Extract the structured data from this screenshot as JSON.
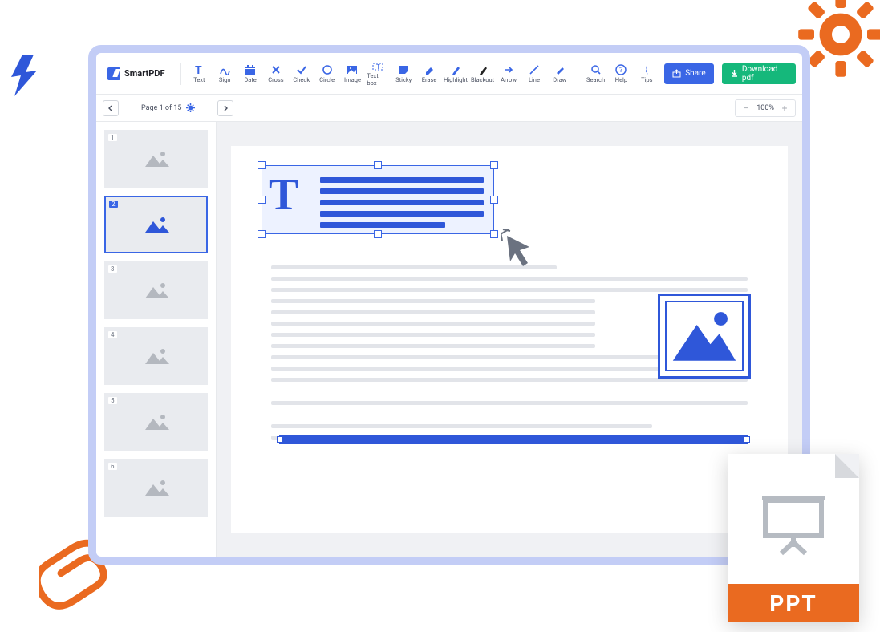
{
  "app": {
    "name": "SmartPDF"
  },
  "toolbar": {
    "tools": [
      {
        "label": "Text"
      },
      {
        "label": "Sign"
      },
      {
        "label": "Date"
      },
      {
        "label": "Cross"
      },
      {
        "label": "Check"
      },
      {
        "label": "Circle"
      },
      {
        "label": "Image"
      },
      {
        "label": "Text box"
      },
      {
        "label": "Sticky"
      },
      {
        "label": "Erase"
      },
      {
        "label": "Highlight"
      },
      {
        "label": "Blackout"
      },
      {
        "label": "Arrow"
      },
      {
        "label": "Line"
      },
      {
        "label": "Draw"
      }
    ],
    "utilities": [
      {
        "label": "Search"
      },
      {
        "label": "Help"
      },
      {
        "label": "Tips"
      }
    ],
    "share": "Share",
    "download": "Download pdf"
  },
  "paginator": {
    "label": "Page 1 of 15",
    "zoom": "100%"
  },
  "thumbnails": {
    "count": 6,
    "active": 2
  },
  "ppt": {
    "label": "PPT"
  }
}
